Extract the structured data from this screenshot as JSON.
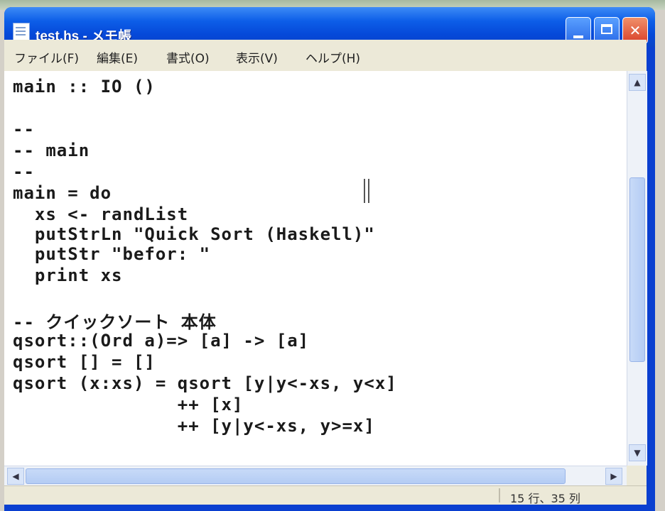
{
  "window": {
    "title": "test.hs - メモ帳",
    "min_glyph": "",
    "max_glyph": "",
    "close_glyph": "✕"
  },
  "menu": [
    "ファイル(F)",
    "編集(E)",
    "書式(O)",
    "表示(V)",
    "ヘルプ(H)"
  ],
  "code_lines": [
    "main :: IO ()",
    "",
    "--",
    "-- main",
    "--",
    "main = do",
    "  xs <- randList",
    "  putStrLn \"Quick Sort (Haskell)\"",
    "  putStr \"befor: \"",
    "  print xs",
    "",
    "-- クイックソート 本体",
    "qsort::(Ord a)=> [a] -> [a]",
    "qsort [] = []",
    "qsort (x:xs) = qsort [y|y<-xs, y<x]",
    "               ++ [x]",
    "               ++ [y|y<-xs, y>=x]"
  ],
  "status": {
    "position": "15 行、35 列"
  },
  "scroll": {
    "up": "▲",
    "down": "▼",
    "left": "◀",
    "right": "▶"
  }
}
